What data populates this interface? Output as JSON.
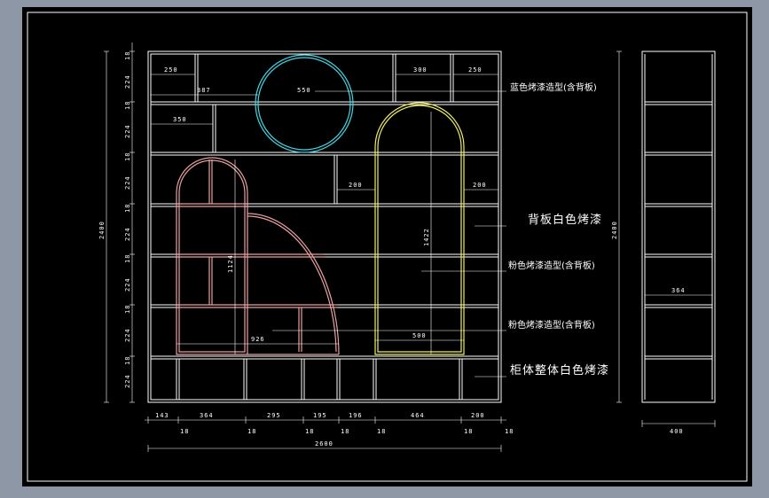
{
  "colors": {
    "background": "#8e97a6",
    "canvas": "#000000",
    "line": "#ffffff",
    "blue_arch": "#3fd6e6",
    "pink_arch": "#e8a0a0",
    "yellow_arch": "#f0f060"
  },
  "annotations": {
    "blue_feature": "蓝色烤漆造型(含背板)",
    "back_panel": "背板白色烤漆",
    "pink_feature_1": "粉色烤漆造型(含背板)",
    "pink_feature_2": "粉色烤漆造型(含背板)",
    "cabinet_body": "柜体整体白色烤漆"
  },
  "dimensions": {
    "top_left_250": "250",
    "top_right_300": "300",
    "top_right_250": "250",
    "width_387": "387",
    "circle_550": "550",
    "left_350": "350",
    "gap_200_left": "200",
    "gap_200_right": "200",
    "arch_height_1422": "1422",
    "pink_height_1124": "1124",
    "pink_width_926": "926",
    "yellow_width_500": "500",
    "side_depth_364": "364",
    "side_width_400": "400",
    "total_height_left": "2400",
    "total_height_right": "2400",
    "overall_width": "2600",
    "bottom_segments": [
      "143",
      "364",
      "295",
      "195",
      "196",
      "464",
      "200"
    ],
    "bottom_thickness": [
      "18",
      "18",
      "18",
      "18",
      "18",
      "18",
      "18"
    ],
    "row_heights": [
      "18",
      "224",
      "18",
      "224",
      "18",
      "224",
      "18",
      "224",
      "18",
      "224",
      "18",
      "224",
      "18",
      "224",
      "18",
      "214"
    ]
  }
}
